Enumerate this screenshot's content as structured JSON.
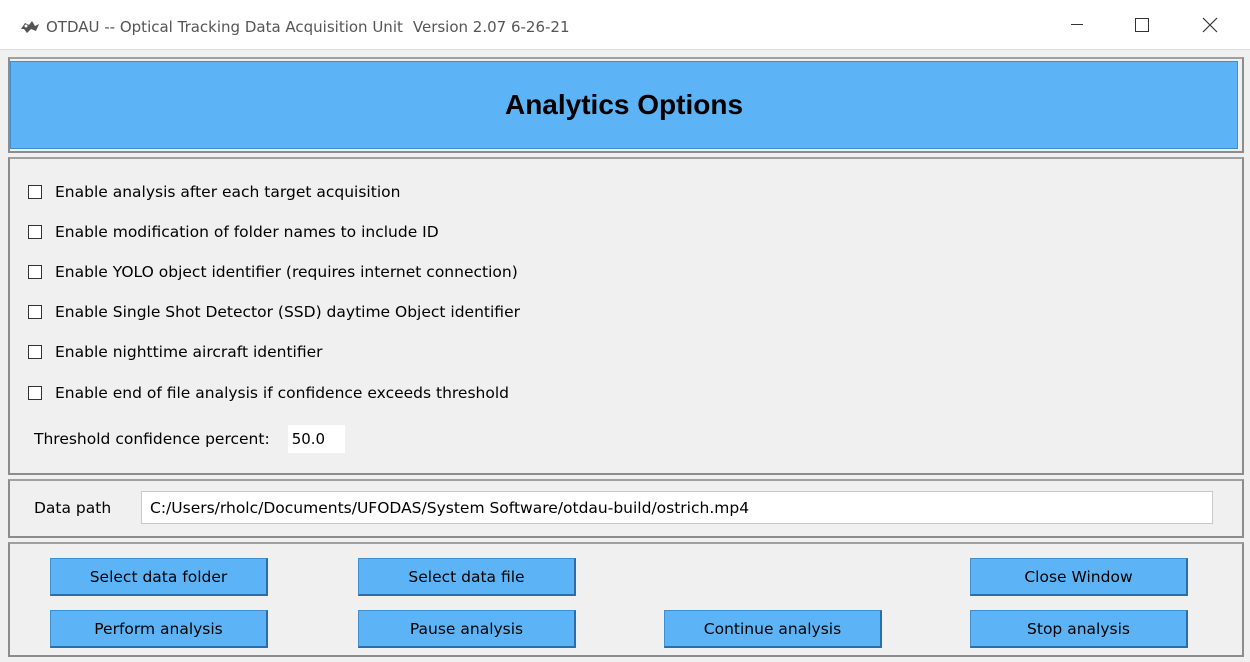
{
  "window": {
    "title": "OTDAU -- Optical Tracking Data Acquisition Unit",
    "version": "Version 2.07  6-26-21"
  },
  "header": {
    "title": "Analytics Options"
  },
  "options": [
    {
      "label": "Enable analysis after each target acquisition",
      "checked": false
    },
    {
      "label": "Enable modification of folder names to include ID",
      "checked": false
    },
    {
      "label": "Enable YOLO object identifier (requires internet connection)",
      "checked": false
    },
    {
      "label": "Enable Single Shot Detector (SSD) daytime Object identifier",
      "checked": false
    },
    {
      "label": "Enable nighttime aircraft identifier",
      "checked": false
    },
    {
      "label": "Enable end of file analysis if confidence exceeds threshold",
      "checked": false
    }
  ],
  "threshold": {
    "label": "Threshold confidence percent:",
    "value": "50.0"
  },
  "data_path": {
    "label": "Data path",
    "value": "C:/Users/rholc/Documents/UFODAS/System Software/otdau-build/ostrich.mp4"
  },
  "buttons": {
    "select_folder": "Select data folder",
    "select_file": "Select data file",
    "close_window": "Close Window",
    "perform": "Perform analysis",
    "pause": "Pause analysis",
    "continue": "Continue analysis",
    "stop": "Stop analysis"
  },
  "colors": {
    "accent": "#5cb3f5"
  }
}
